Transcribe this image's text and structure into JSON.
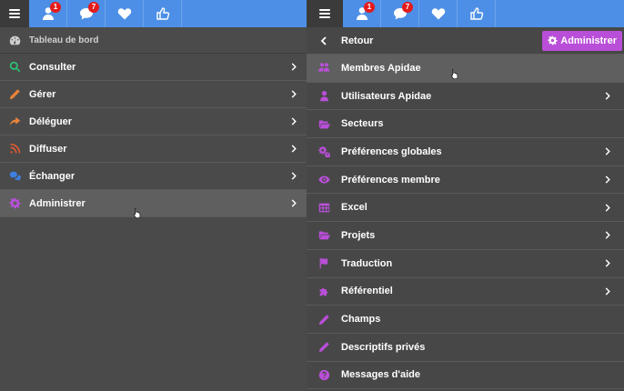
{
  "left": {
    "badges": {
      "users": "1",
      "messages": "7"
    },
    "dashboard": "Tableau de bord",
    "items": [
      {
        "label": "Consulter",
        "icon": "search-icon",
        "color": "#2fbf71"
      },
      {
        "label": "Gérer",
        "icon": "pencil-icon",
        "color": "#e8833a"
      },
      {
        "label": "Déléguer",
        "icon": "share-icon",
        "color": "#e8833a"
      },
      {
        "label": "Diffuser",
        "icon": "rss-icon",
        "color": "#e45a30"
      },
      {
        "label": "Échanger",
        "icon": "chat-icon",
        "color": "#3c7fe0"
      },
      {
        "label": "Administrer",
        "icon": "gear-icon",
        "color": "#b94fd8"
      }
    ]
  },
  "right": {
    "badges": {
      "users": "1",
      "messages": "7"
    },
    "back": "Retour",
    "admin_button": "Administrer",
    "items": [
      {
        "label": "Membres Apidae",
        "icon": "users-icon",
        "chevron": false
      },
      {
        "label": "Utilisateurs Apidae",
        "icon": "user-icon",
        "chevron": true
      },
      {
        "label": "Secteurs",
        "icon": "folder-open-icon",
        "chevron": false
      },
      {
        "label": "Préférences globales",
        "icon": "gears-icon",
        "chevron": true
      },
      {
        "label": "Préférences membre",
        "icon": "eye-icon",
        "chevron": true
      },
      {
        "label": "Excel",
        "icon": "table-icon",
        "chevron": true
      },
      {
        "label": "Projets",
        "icon": "folder-open-icon",
        "chevron": true
      },
      {
        "label": "Traduction",
        "icon": "flag-icon",
        "chevron": true
      },
      {
        "label": "Référentiel",
        "icon": "puzzle-icon",
        "chevron": true
      },
      {
        "label": "Champs",
        "icon": "pencil-icon",
        "chevron": false
      },
      {
        "label": "Descriptifs privés",
        "icon": "pencil-icon",
        "chevron": false
      },
      {
        "label": "Messages d'aide",
        "icon": "question-icon",
        "chevron": false
      }
    ],
    "accent": "#b94fd8"
  }
}
